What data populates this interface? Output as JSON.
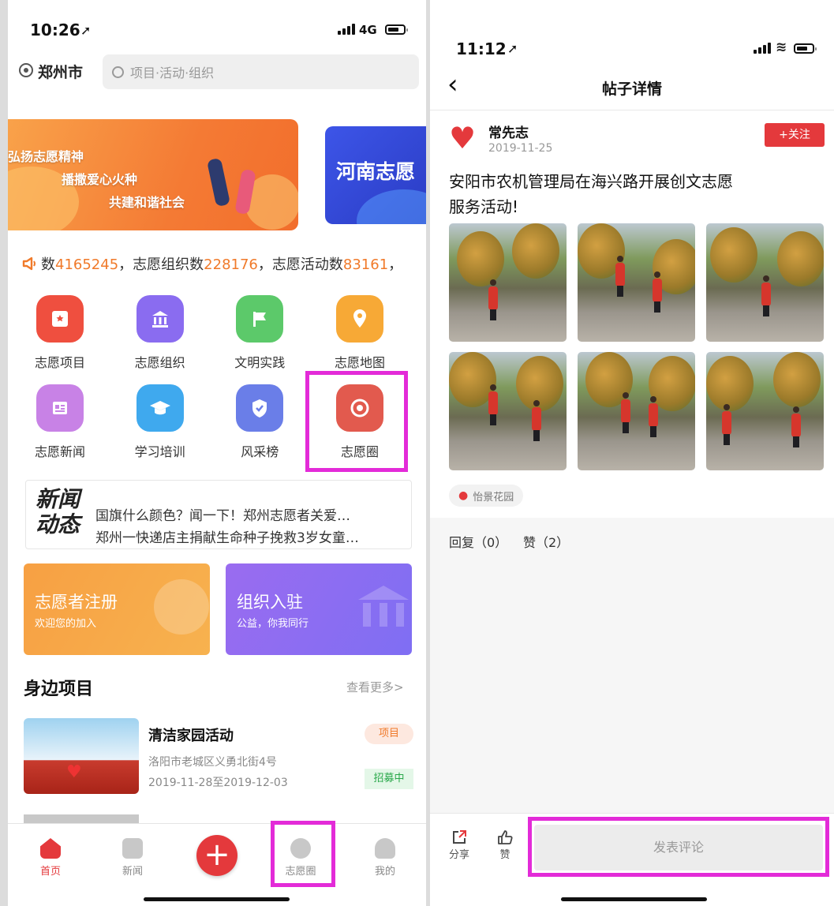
{
  "colors": {
    "accent": "#e4393c",
    "magenta": "#e32bd8",
    "orange": "#f07a2a",
    "purple": "#8a6cf0"
  },
  "left": {
    "status": {
      "time": "10:26",
      "network": "4G"
    },
    "city": "郑州市",
    "search": {
      "placeholder": "项目·活动·组织"
    },
    "banner": {
      "line1": "弘扬志愿精神",
      "line2": "播撒爱心火种",
      "line3": "共建和谐社会",
      "side_title": "河南志愿"
    },
    "notice": {
      "prefix": "数",
      "volunteers": "4165245",
      "mid1": "，志愿组织数",
      "orgs": "228176",
      "mid2": "，志愿活动数",
      "activities": "83161",
      "suffix": "，"
    },
    "grid": [
      {
        "label": "志愿项目",
        "icon": "bookmark-icon",
        "color": "#ef4f3f"
      },
      {
        "label": "志愿组织",
        "icon": "institution-icon",
        "color": "#8a6cf0"
      },
      {
        "label": "文明实践",
        "icon": "flag-icon",
        "color": "#5cc96a"
      },
      {
        "label": "志愿地图",
        "icon": "map-pin-icon",
        "color": "#f7a936"
      },
      {
        "label": "志愿新闻",
        "icon": "newspaper-icon",
        "color": "#c882e6"
      },
      {
        "label": "学习培训",
        "icon": "graduation-cap-icon",
        "color": "#3fa9ee"
      },
      {
        "label": "风采榜",
        "icon": "shield-check-icon",
        "color": "#6a7ee8"
      },
      {
        "label": "志愿圈",
        "icon": "target-icon",
        "color": "#e25a4e"
      }
    ],
    "news": {
      "logo": "新闻\n动态",
      "items": [
        "国旗什么颜色？闻一下！郑州志愿者关爱…",
        "郑州一快递店主捐献生命种子挽救3岁女童…"
      ]
    },
    "cards": [
      {
        "title": "志愿者注册",
        "sub": "欢迎您的加入"
      },
      {
        "title": "组织入驻",
        "sub": "公益，你我同行"
      }
    ],
    "nearby": {
      "title": "身边项目",
      "more": "查看更多>"
    },
    "project": {
      "name": "清洁家园活动",
      "address": "洛阳市老城区义勇北街4号",
      "dates": "2019-11-28至2019-12-03",
      "tag": "项目",
      "status": "招募中"
    },
    "tabs": [
      {
        "label": "首页",
        "icon": "home-icon"
      },
      {
        "label": "新闻",
        "icon": "news-icon"
      },
      {
        "label": "",
        "icon": "plus-icon"
      },
      {
        "label": "志愿圈",
        "icon": "eye-icon"
      },
      {
        "label": "我的",
        "icon": "user-icon"
      }
    ]
  },
  "right": {
    "status": {
      "time": "11:12"
    },
    "nav": {
      "back": "‹",
      "title": "帖子详情"
    },
    "post": {
      "author": "常先志",
      "date": "2019-11-25",
      "follow": "+关注",
      "text_line1": "安阳市农机管理局在海兴路开展创文志愿",
      "text_line2": "服务活动!",
      "location": "怡景花园",
      "replies": "回复（0）",
      "likes": "赞（2）"
    },
    "bottom": {
      "share": "分享",
      "like": "赞",
      "comment_placeholder": "发表评论"
    }
  }
}
